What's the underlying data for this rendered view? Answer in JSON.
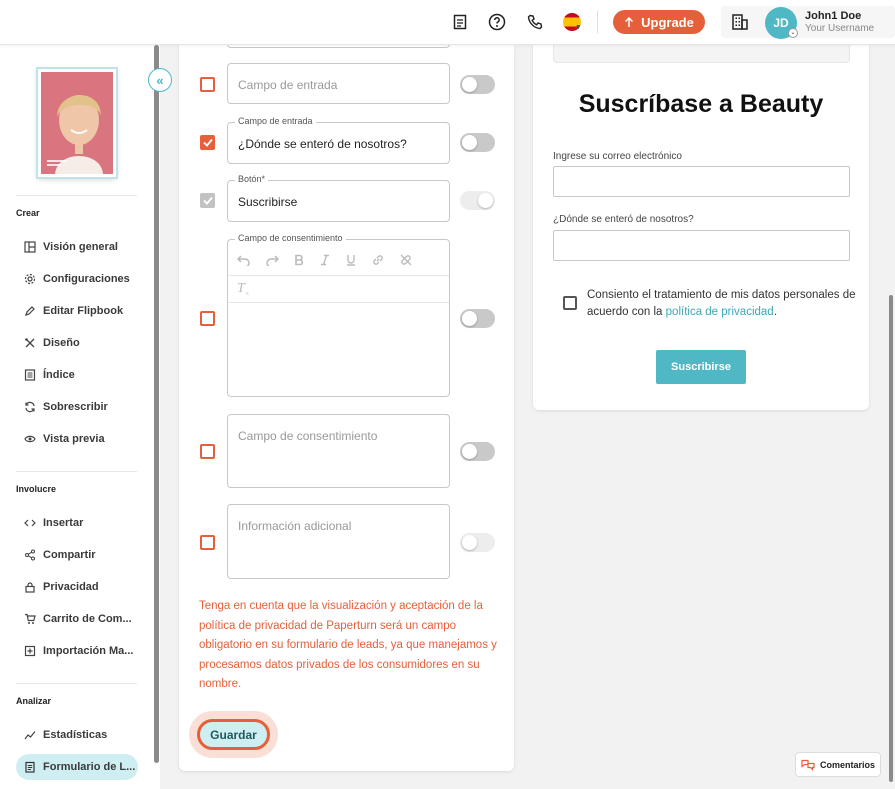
{
  "topbar": {
    "upgrade_label": "Upgrade",
    "user_initials": "JD",
    "user_name": "John1 Doe",
    "user_subtitle": "Your Username",
    "language_flag": "spain-flag"
  },
  "sidebar": {
    "collapse_glyph": "«",
    "sections": [
      {
        "heading": "Crear",
        "items": [
          "Visión general",
          "Configuraciones",
          "Editar Flipbook",
          "Diseño",
          "Índice",
          "Sobrescribir",
          "Vista previa"
        ]
      },
      {
        "heading": "Involucre",
        "items": [
          "Insertar",
          "Compartir",
          "Privacidad",
          "Carrito de Com...",
          "Importación Ma..."
        ]
      },
      {
        "heading": "Analizar",
        "items": [
          "Estadísticas",
          "Formulario de L..."
        ]
      }
    ]
  },
  "form_editor": {
    "row1": {
      "placeholder": "Campo de entrada"
    },
    "row2": {
      "legend": "Campo de entrada",
      "value": "¿Dónde se enteró de nosotros?"
    },
    "row3": {
      "legend": "Botón*",
      "value": "Suscribirse"
    },
    "row4": {
      "legend": "Campo de consentimiento",
      "clear_format_glyph": "T"
    },
    "row5": {
      "placeholder": "Campo de consentimiento"
    },
    "row6": {
      "placeholder": "Información adicional"
    },
    "note": "Tenga en cuenta que la visualización y aceptación de la política de privacidad de Paperturn será un campo obligatorio en su formulario de leads, ya que manejamos y procesamos datos privados de los consumidores en su nombre.",
    "save_label": "Guardar"
  },
  "preview": {
    "title": "Suscríbase a Beauty",
    "email_label": "Ingrese su correo electrónico",
    "source_label": "¿Dónde se enteró de nosotros?",
    "consent_text": "Consiento el tratamiento de mis datos personales de acuerdo con la",
    "consent_link": "política de privacidad",
    "consent_end": ".",
    "submit_label": "Suscribirse"
  },
  "comments_label": "Comentarios",
  "colors": {
    "accent": "#e5603a",
    "teal": "#4fb8c4",
    "active_bg": "#cfeef1"
  }
}
